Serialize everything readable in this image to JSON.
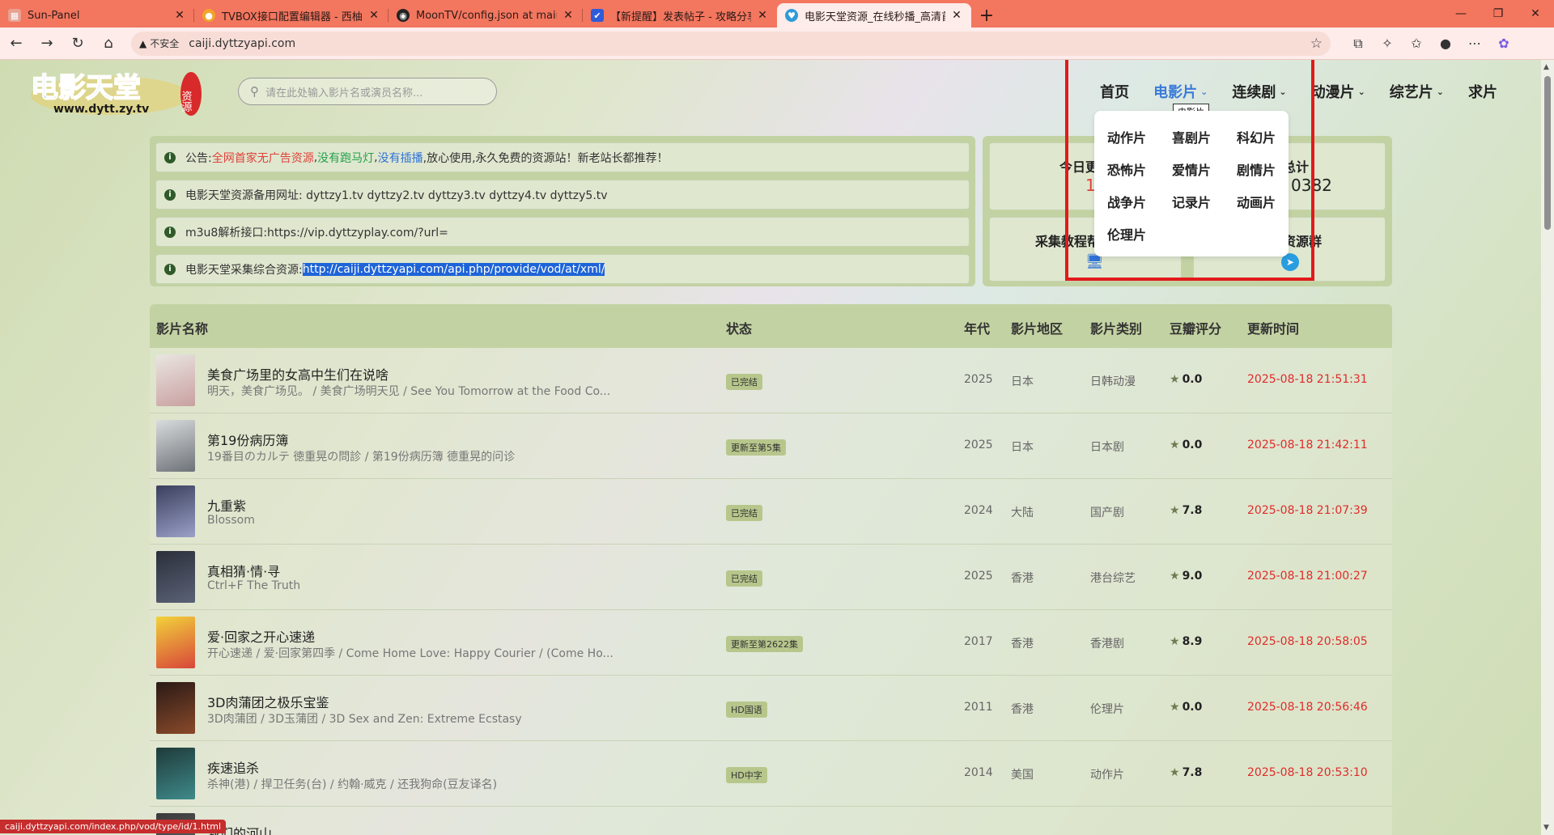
{
  "browser": {
    "tabs": [
      {
        "title": "Sun-Panel",
        "favicon": "grid-icon",
        "color": "#e8a090"
      },
      {
        "title": "TVBOX接口配置编辑器 - 西柚吧",
        "favicon": "grapefruit-icon",
        "color": "#f2a42b"
      },
      {
        "title": "MoonTV/config.json at main · sar",
        "favicon": "github-icon",
        "color": "#222222"
      },
      {
        "title": "【新提醒】发表帖子 - 攻略分享",
        "favicon": "forum-icon",
        "color": "#2f5bd8"
      },
      {
        "title": "电影天堂资源_在线秒播_高清首发",
        "favicon": "heart-icon",
        "color": "#2f9bd8",
        "active": true
      }
    ],
    "new_tab": "+",
    "window_controls": {
      "minimize": "—",
      "restore": "❐",
      "close": "✕"
    },
    "address": {
      "insecure_label": "不安全",
      "url": "caiji.dyttzyapi.com"
    },
    "status_url": "caiji.dyttzyapi.com/index.php/vod/type/id/1.html"
  },
  "site": {
    "search_placeholder": "请在此处输入影片名或演员名称...",
    "logo": {
      "main": "电影天堂",
      "domain": "www.dytt.zy.tv",
      "seal": "资源"
    },
    "nav": [
      {
        "label": "首页",
        "dropdown": false,
        "active": false
      },
      {
        "label": "电影片",
        "dropdown": true,
        "active": true
      },
      {
        "label": "连续剧",
        "dropdown": true,
        "active": false
      },
      {
        "label": "动漫片",
        "dropdown": true,
        "active": false
      },
      {
        "label": "综艺片",
        "dropdown": true,
        "active": false
      },
      {
        "label": "求片",
        "dropdown": false,
        "active": false
      }
    ],
    "tooltip": "电影片",
    "dropdown_items": [
      "动作片",
      "喜剧片",
      "科幻片",
      "恐怖片",
      "爱情片",
      "剧情片",
      "战争片",
      "记录片",
      "动画片",
      "伦理片"
    ]
  },
  "notices": {
    "n1": {
      "prefix": "公告:",
      "red": "全网首家无广告资源",
      "sep1": ",",
      "green": "没有跑马灯",
      "sep2": ",",
      "blue": "没有插播",
      "rest": ",放心使用,永久免费的资源站！新老站长都推荐！"
    },
    "n2": "电影天堂资源备用网址: dyttzy1.tv dyttzy2.tv dyttzy3.tv dyttzy4.tv dyttzy5.tv",
    "n3": "m3u8解析接口:https://vip.dyttzyplay.com/?url=",
    "n4": {
      "prefix": "电影天堂采集综合资源:",
      "link": "http://caiji.dyttzyapi.com/api.php/provide/vod/at/xml/"
    }
  },
  "stats": {
    "today_label": "今日更",
    "today_value": "1",
    "total_label": "总计",
    "total_value": "0382",
    "tutorial_label": "采集教程帮",
    "group_label": "资源群"
  },
  "table": {
    "headers": {
      "name": "影片名称",
      "status": "状态",
      "year": "年代",
      "region": "影片地区",
      "category": "影片类别",
      "rating": "豆瓣评分",
      "updated": "更新时间"
    },
    "rows": [
      {
        "title": "美食广场里的女高中生们在说啥",
        "alt": "明天，美食广场见。 / 美食广场明天见 / See You Tomorrow at the Food Co...",
        "status": "已完结",
        "year": "2025",
        "region": "日本",
        "category": "日韩动漫",
        "rating": "0.0",
        "updated": "2025-08-18 21:51:31",
        "poster": [
          "#e9e6e2",
          "#c9a0a0"
        ]
      },
      {
        "title": "第19份病历簿",
        "alt": "19番目のカルテ 徳重晃の問診 / 第19份病历簿 德重晃的问诊",
        "status": "更新至第5集",
        "year": "2025",
        "region": "日本",
        "category": "日本剧",
        "rating": "0.0",
        "updated": "2025-08-18 21:42:11",
        "poster": [
          "#d9dcdd",
          "#6d7278"
        ]
      },
      {
        "title": "九重紫",
        "alt": "Blossom",
        "status": "已完结",
        "year": "2024",
        "region": "大陆",
        "category": "国产剧",
        "rating": "7.8",
        "updated": "2025-08-18 21:07:39",
        "poster": [
          "#3a3f5c",
          "#9aa0c8"
        ]
      },
      {
        "title": "真相猜·情·寻",
        "alt": "Ctrl+F The Truth",
        "status": "已完结",
        "year": "2025",
        "region": "香港",
        "category": "港台综艺",
        "rating": "9.0",
        "updated": "2025-08-18 21:00:27",
        "poster": [
          "#2b2f3a",
          "#5a6276"
        ]
      },
      {
        "title": "爱·回家之开心速递",
        "alt": "开心速递 / 爱·回家第四季 / Come Home Love: Happy Courier / (Come Ho...",
        "status": "更新至第2622集",
        "year": "2017",
        "region": "香港",
        "category": "香港剧",
        "rating": "8.9",
        "updated": "2025-08-18 20:58:05",
        "poster": [
          "#f2d23a",
          "#d8463a"
        ]
      },
      {
        "title": "3D肉蒲团之极乐宝鉴",
        "alt": "3D肉蒲团 / 3D玉蒲团 / 3D Sex and Zen: Extreme Ecstasy",
        "status": "HD国语",
        "year": "2011",
        "region": "香港",
        "category": "伦理片",
        "rating": "0.0",
        "updated": "2025-08-18 20:56:46",
        "poster": [
          "#2a1a16",
          "#8a4a2a"
        ]
      },
      {
        "title": "疾速追杀",
        "alt": "杀神(港) / 捍卫任务(台) / 约翰·威克 / 还我狗命(豆友译名)",
        "status": "HD中字",
        "year": "2014",
        "region": "美国",
        "category": "动作片",
        "rating": "7.8",
        "updated": "2025-08-18 20:53:10",
        "poster": [
          "#1f3a3a",
          "#3f8a8a"
        ]
      },
      {
        "title": "我们的河山",
        "alt": "",
        "status": "",
        "year": "",
        "region": "",
        "category": "",
        "rating": "",
        "updated": "",
        "poster": [
          "#3a3a3a",
          "#6a6a6a"
        ]
      }
    ]
  }
}
